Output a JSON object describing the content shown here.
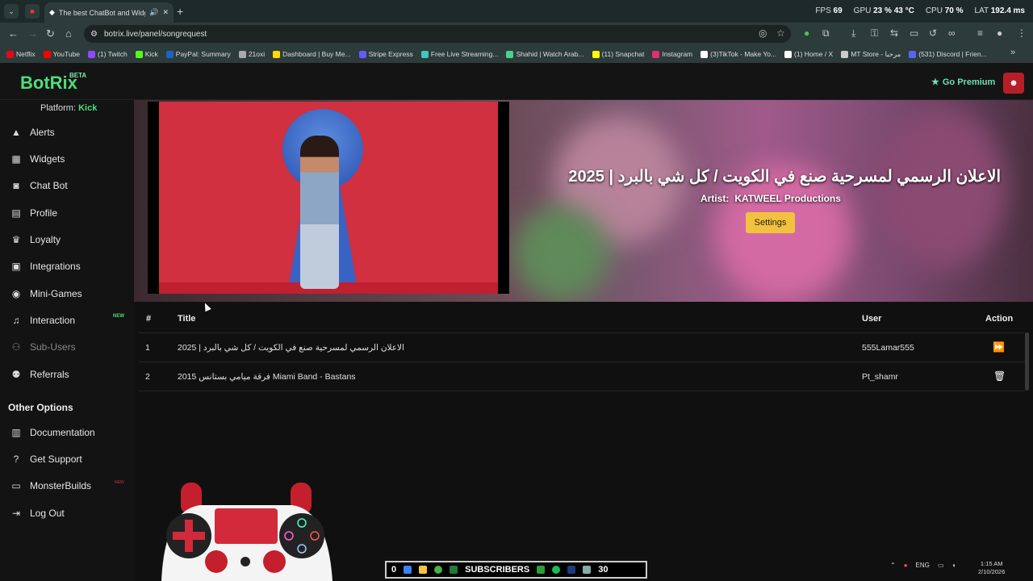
{
  "browser": {
    "tab_title": "The best ChatBot and Widg",
    "url": "botrix.live/panel/songrequest",
    "hud": {
      "fps_label": "FPS",
      "fps": "69",
      "gpu_label": "GPU",
      "gpu": "23 % 43 °C",
      "cpu_label": "CPU",
      "cpu": "70 %",
      "lat_label": "LAT",
      "lat": "192.4 ms"
    },
    "bookmarks": [
      {
        "label": "Netflix",
        "color": "#e50914"
      },
      {
        "label": "YouTube",
        "color": "#ff0000"
      },
      {
        "label": "(1) Twitch",
        "color": "#9146ff"
      },
      {
        "label": "Kick",
        "color": "#53fc18"
      },
      {
        "label": "PayPal: Summary",
        "color": "#1e63c4"
      },
      {
        "label": "21oxi",
        "color": "#aaaaaa"
      },
      {
        "label": "Dashboard | Buy Me...",
        "color": "#ffdd00"
      },
      {
        "label": "Stripe Express",
        "color": "#635bff"
      },
      {
        "label": "Free Live Streaming...",
        "color": "#3ec6c0"
      },
      {
        "label": "Shahid | Watch Arab...",
        "color": "#4ad38a"
      },
      {
        "label": "(11) Snapchat",
        "color": "#fffc00"
      },
      {
        "label": "Instagram",
        "color": "#e1306c"
      },
      {
        "label": "(3)TikTok - Make Yo...",
        "color": "#ffffff"
      },
      {
        "label": "(1) Home / X",
        "color": "#ffffff"
      },
      {
        "label": "MT Store - مرحبا",
        "color": "#cccccc"
      },
      {
        "label": "(531) Discord | Frien...",
        "color": "#5865f2"
      }
    ]
  },
  "header": {
    "logo": "BotRix",
    "beta": "BETA",
    "premium": "Go Premium"
  },
  "sidebar": {
    "platform_label": "Platform:",
    "platform_value": "Kick",
    "items": [
      {
        "label": "Alerts",
        "icon": "warning-icon"
      },
      {
        "label": "Widgets",
        "icon": "grid-icon"
      },
      {
        "label": "Chat Bot",
        "icon": "robot-icon"
      },
      {
        "label": "Profile",
        "icon": "id-card-icon"
      },
      {
        "label": "Loyalty",
        "icon": "trophy-icon"
      },
      {
        "label": "Integrations",
        "icon": "chat-icon"
      },
      {
        "label": "Mini-Games",
        "icon": "gamepad-icon"
      },
      {
        "label": "Interaction",
        "icon": "music-icon"
      },
      {
        "label": "Sub-Users",
        "icon": "users-icon"
      },
      {
        "label": "Referrals",
        "icon": "user-group-icon"
      }
    ],
    "new_badge": "NEW",
    "other_heading": "Other Options",
    "other_items": [
      {
        "label": "Documentation",
        "icon": "book-icon"
      },
      {
        "label": "Get Support",
        "icon": "question-icon"
      },
      {
        "label": "MonsterBuilds",
        "icon": "laptop-icon"
      },
      {
        "label": "Log Out",
        "icon": "logout-icon"
      }
    ]
  },
  "now_playing": {
    "title": "الاعلان الرسمي لمسرحية صنع في الكويت / كل شي بالبرد | 2025",
    "artist_label": "Artist:",
    "artist": "KATWEEL Productions",
    "settings_label": "Settings"
  },
  "queue": {
    "headers": {
      "num": "#",
      "title": "Title",
      "user": "User",
      "action": "Action"
    },
    "rows": [
      {
        "num": "1",
        "title": "الاعلان الرسمي لمسرحية صنع في الكويت / كل شي بالبرد | 2025",
        "user": "555Lamar555",
        "action": "skip-icon"
      },
      {
        "num": "2",
        "title": "فرقة ميامي بستانس 2015 Miami Band - Bastans",
        "user": "Pt_shamr",
        "action": "trash-icon"
      }
    ]
  },
  "overlay": {
    "subs_left": "0",
    "subs_label": "SUBSCRIBERS",
    "subs_right": "30"
  },
  "taskbar": {
    "lang": "ENG",
    "time": "1:15 AM",
    "date": "2/10/2026"
  }
}
